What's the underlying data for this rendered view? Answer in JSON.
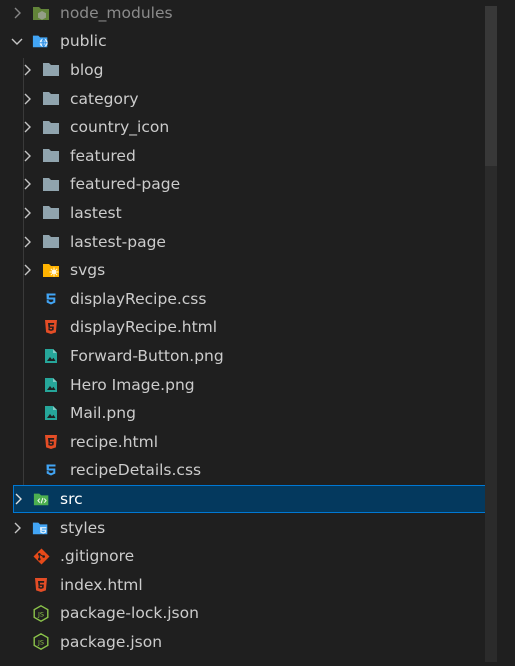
{
  "explorer": {
    "items": [
      {
        "label": "node_modules",
        "kind": "folder-node"
      },
      {
        "label": "public",
        "kind": "folder-public"
      },
      {
        "label": "blog",
        "kind": "folder"
      },
      {
        "label": "category",
        "kind": "folder"
      },
      {
        "label": "country_icon",
        "kind": "folder"
      },
      {
        "label": "featured",
        "kind": "folder"
      },
      {
        "label": "featured-page",
        "kind": "folder"
      },
      {
        "label": "lastest",
        "kind": "folder"
      },
      {
        "label": "lastest-page",
        "kind": "folder"
      },
      {
        "label": "svgs",
        "kind": "folder-svg"
      },
      {
        "label": "displayRecipe.css",
        "kind": "css-file"
      },
      {
        "label": "displayRecipe.html",
        "kind": "html-file"
      },
      {
        "label": "Forward-Button.png",
        "kind": "image-file"
      },
      {
        "label": "Hero Image.png",
        "kind": "image-file"
      },
      {
        "label": "Mail.png",
        "kind": "image-file"
      },
      {
        "label": "recipe.html",
        "kind": "html-file"
      },
      {
        "label": "recipeDetails.css",
        "kind": "css-file"
      },
      {
        "label": "src",
        "kind": "folder-src"
      },
      {
        "label": "styles",
        "kind": "folder-styles"
      },
      {
        "label": ".gitignore",
        "kind": "git-file"
      },
      {
        "label": "index.html",
        "kind": "html-file"
      },
      {
        "label": "package-lock.json",
        "kind": "json-file"
      },
      {
        "label": "package.json",
        "kind": "json-file"
      }
    ]
  },
  "colors": {
    "background": "#1f1f1f",
    "selection": "#04395e",
    "selection_border": "#0078d4",
    "folder": "#90a4ae",
    "css": "#42a5f5",
    "html": "#e44d26",
    "image": "#26a69a",
    "json": "#8bc34a",
    "git": "#e64a19"
  }
}
